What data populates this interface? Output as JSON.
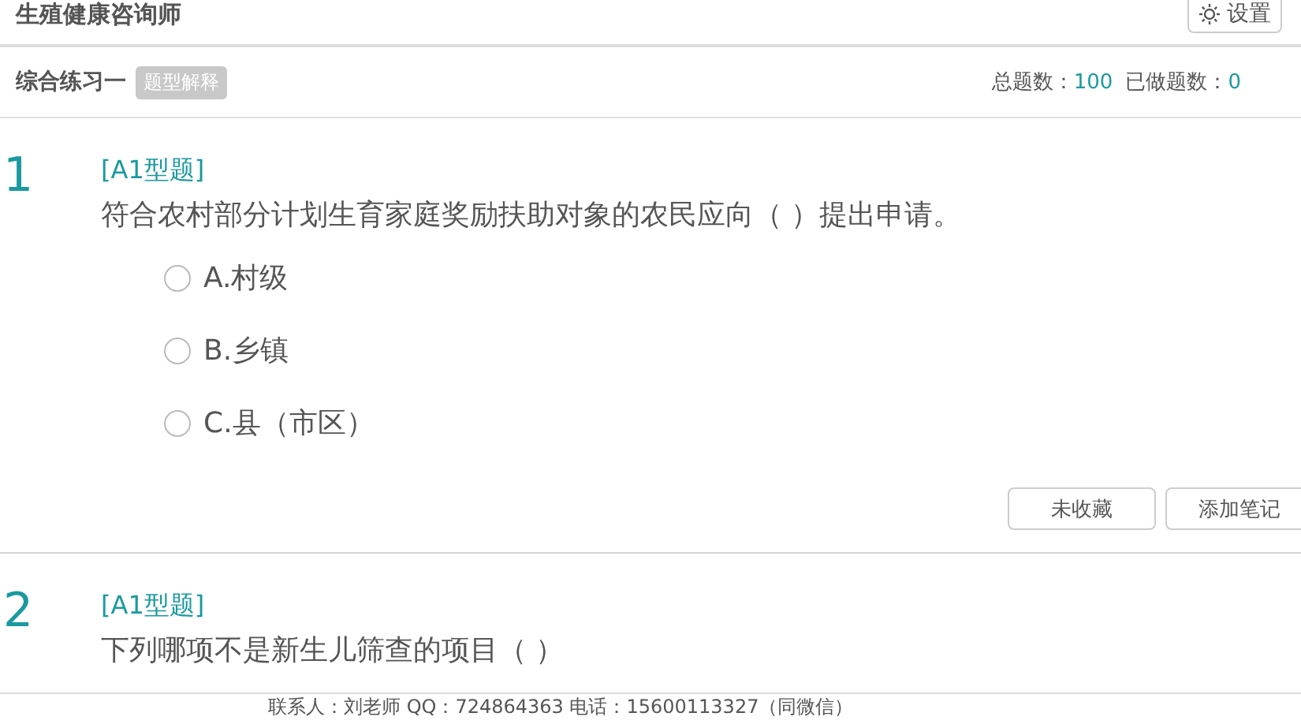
{
  "header": {
    "title": "生殖健康咨询师",
    "settings_button": "设置"
  },
  "subheader": {
    "title": "综合练习一",
    "badge": "题型解释",
    "total_label": "总题数：",
    "total": "100",
    "done_label": "已做题数：",
    "done": "0"
  },
  "questions": [
    {
      "number": "1",
      "type": "[A1型题]",
      "text": "符合农村部分计划生育家庭奖励扶助对象的农民应向（ ）提出申请。",
      "options": [
        {
          "label": "A.村级",
          "selected": false
        },
        {
          "label": "B.乡镇",
          "selected": false
        },
        {
          "label": "C.县（市区）",
          "selected": false
        }
      ],
      "buttons": [
        "未收藏",
        "添加笔记"
      ]
    },
    {
      "number": "2",
      "type": "[A1型题]",
      "text": "下列哪项不是新生儿筛查的项目（ ）"
    }
  ],
  "footer": "联系人：刘老师   QQ：724864363   电话：15600113327（同微信）"
}
